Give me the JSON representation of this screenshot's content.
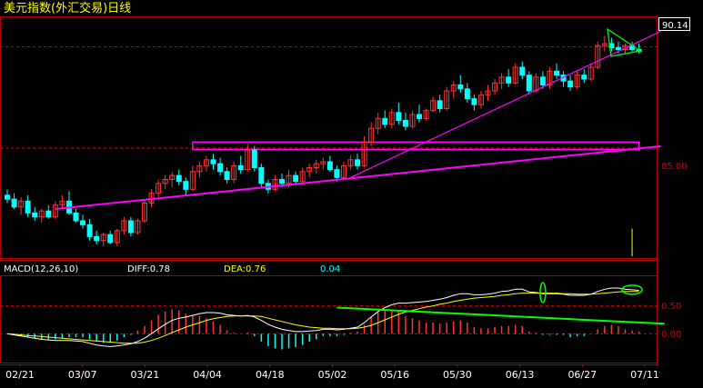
{
  "window": {
    "title": "美元指数(外汇交易)日线"
  },
  "price_panel": {
    "current_price_label": "90.14",
    "level_label": "85.00"
  },
  "macd_panel": {
    "indicator_label": "MACD(12,26,10)",
    "diff_label": "DIFF:0.78",
    "dea_label": "DEA:0.76",
    "macd_value": "0.04",
    "level_high_label": "0.50",
    "level_zero_label": "0.00"
  },
  "colors": {
    "background": "#000000",
    "up_candle": "#ff3333",
    "down_candle": "#00ffff",
    "title_text": "#ffff00",
    "trendline": "#ff00ff",
    "diff_line": "#ffffff",
    "dea_line": "#ffff00",
    "annotation_green": "#00ff00",
    "axis_red": "#cc0000"
  },
  "chart_data": [
    {
      "type": "candlestick",
      "title": "美元指数(外汇交易)日线",
      "x_tick_labels": [
        "02/21",
        "03/07",
        "03/21",
        "04/04",
        "04/18",
        "05/02",
        "05/16",
        "05/30",
        "06/13",
        "06/27",
        "07/11"
      ],
      "ylim": [
        79.5,
        91.5
      ],
      "y_reference_levels": [
        85.0,
        90.14
      ],
      "ohlc": [
        [
          82.6,
          82.9,
          82.2,
          82.4
        ],
        [
          82.4,
          82.7,
          81.9,
          82.0
        ],
        [
          82.0,
          82.5,
          81.6,
          82.3
        ],
        [
          82.3,
          82.6,
          81.5,
          81.7
        ],
        [
          81.7,
          82.0,
          81.3,
          81.5
        ],
        [
          81.5,
          81.9,
          81.2,
          81.8
        ],
        [
          81.8,
          82.1,
          81.4,
          81.5
        ],
        [
          81.5,
          82.3,
          81.4,
          82.1
        ],
        [
          82.1,
          82.6,
          81.9,
          82.3
        ],
        [
          82.3,
          82.8,
          81.6,
          81.7
        ],
        [
          81.7,
          81.9,
          81.2,
          81.3
        ],
        [
          81.3,
          81.6,
          80.9,
          81.1
        ],
        [
          81.1,
          81.4,
          80.3,
          80.5
        ],
        [
          80.5,
          80.8,
          80.1,
          80.3
        ],
        [
          80.3,
          80.7,
          80.0,
          80.6
        ],
        [
          80.6,
          80.8,
          80.1,
          80.2
        ],
        [
          80.2,
          80.9,
          80.0,
          80.8
        ],
        [
          80.8,
          81.5,
          80.6,
          81.3
        ],
        [
          81.3,
          81.5,
          80.5,
          80.7
        ],
        [
          80.7,
          81.4,
          80.6,
          81.3
        ],
        [
          81.3,
          82.4,
          81.2,
          82.2
        ],
        [
          82.2,
          82.9,
          82.0,
          82.7
        ],
        [
          82.7,
          83.4,
          82.5,
          83.2
        ],
        [
          83.2,
          83.6,
          82.9,
          83.4
        ],
        [
          83.4,
          83.8,
          83.0,
          83.6
        ],
        [
          83.6,
          83.9,
          83.1,
          83.3
        ],
        [
          83.3,
          83.5,
          82.6,
          82.9
        ],
        [
          82.9,
          84.1,
          82.8,
          83.8
        ],
        [
          83.8,
          84.3,
          83.5,
          84.1
        ],
        [
          84.1,
          84.6,
          83.8,
          84.4
        ],
        [
          84.4,
          84.7,
          83.9,
          84.2
        ],
        [
          84.2,
          84.5,
          83.6,
          83.8
        ],
        [
          83.8,
          84.0,
          83.2,
          83.4
        ],
        [
          83.4,
          84.3,
          83.2,
          84.1
        ],
        [
          84.1,
          84.6,
          83.7,
          83.9
        ],
        [
          83.9,
          85.2,
          83.8,
          84.9
        ],
        [
          84.9,
          85.1,
          83.8,
          84.0
        ],
        [
          84.0,
          84.2,
          83.0,
          83.2
        ],
        [
          83.2,
          83.4,
          82.7,
          82.9
        ],
        [
          82.9,
          83.6,
          82.8,
          83.4
        ],
        [
          83.4,
          83.7,
          83.0,
          83.2
        ],
        [
          83.2,
          83.9,
          83.0,
          83.6
        ],
        [
          83.6,
          83.8,
          83.1,
          83.3
        ],
        [
          83.3,
          84.0,
          83.2,
          83.8
        ],
        [
          83.8,
          84.2,
          83.5,
          84.0
        ],
        [
          84.0,
          84.4,
          83.7,
          84.2
        ],
        [
          84.2,
          84.5,
          83.9,
          84.3
        ],
        [
          84.3,
          84.6,
          83.8,
          83.9
        ],
        [
          83.9,
          84.1,
          83.3,
          83.5
        ],
        [
          83.5,
          84.3,
          83.4,
          84.1
        ],
        [
          84.1,
          84.6,
          83.9,
          84.4
        ],
        [
          84.4,
          84.7,
          83.9,
          84.1
        ],
        [
          84.1,
          85.6,
          84.0,
          85.3
        ],
        [
          85.3,
          86.3,
          85.1,
          86.0
        ],
        [
          86.0,
          86.8,
          85.7,
          86.5
        ],
        [
          86.5,
          86.9,
          86.0,
          86.2
        ],
        [
          86.2,
          87.0,
          86.0,
          86.8
        ],
        [
          86.8,
          87.3,
          86.2,
          86.4
        ],
        [
          86.4,
          86.8,
          85.9,
          86.1
        ],
        [
          86.1,
          86.9,
          86.0,
          86.7
        ],
        [
          86.7,
          87.2,
          86.3,
          86.5
        ],
        [
          86.5,
          87.0,
          86.4,
          86.9
        ],
        [
          86.9,
          87.6,
          86.8,
          87.4
        ],
        [
          87.4,
          87.7,
          86.8,
          87.0
        ],
        [
          87.0,
          88.1,
          86.9,
          87.9
        ],
        [
          87.9,
          88.4,
          87.5,
          88.2
        ],
        [
          88.2,
          88.7,
          87.8,
          88.0
        ],
        [
          88.0,
          88.3,
          87.3,
          87.5
        ],
        [
          87.5,
          87.7,
          86.9,
          87.2
        ],
        [
          87.2,
          87.9,
          87.0,
          87.7
        ],
        [
          87.7,
          88.2,
          87.4,
          87.9
        ],
        [
          87.9,
          88.5,
          87.7,
          88.3
        ],
        [
          88.3,
          88.8,
          88.0,
          88.6
        ],
        [
          88.6,
          89.0,
          88.1,
          88.3
        ],
        [
          88.3,
          89.3,
          88.2,
          89.1
        ],
        [
          89.1,
          89.4,
          88.5,
          88.7
        ],
        [
          88.7,
          88.9,
          87.7,
          87.9
        ],
        [
          87.9,
          88.8,
          87.8,
          88.6
        ],
        [
          88.6,
          88.9,
          88.0,
          88.2
        ],
        [
          88.2,
          89.1,
          88.0,
          88.9
        ],
        [
          88.9,
          89.3,
          88.5,
          88.7
        ],
        [
          88.7,
          88.9,
          88.1,
          88.4
        ],
        [
          88.4,
          88.7,
          87.9,
          88.1
        ],
        [
          88.1,
          88.9,
          88.0,
          88.7
        ],
        [
          88.7,
          89.0,
          88.3,
          88.5
        ],
        [
          88.5,
          89.3,
          88.4,
          89.1
        ],
        [
          89.1,
          90.4,
          89.0,
          90.2
        ],
        [
          90.2,
          90.7,
          89.9,
          90.3
        ],
        [
          90.3,
          90.6,
          89.9,
          90.1
        ],
        [
          90.1,
          90.4,
          89.8,
          90.0
        ],
        [
          90.0,
          90.3,
          89.8,
          90.2
        ],
        [
          90.2,
          90.4,
          89.9,
          90.0
        ],
        [
          90.0,
          90.3,
          89.8,
          89.9
        ]
      ],
      "trendlines": [
        {
          "from": [
            7,
            81.9
          ],
          "to": [
            92,
            85.0
          ]
        },
        {
          "from": [
            50,
            83.5
          ],
          "to": [
            92,
            90.0
          ]
        }
      ],
      "rectangle_zone": {
        "x_from": 27,
        "x_to": 92,
        "y_from": 85.0,
        "y_to": 85.3
      }
    },
    {
      "type": "macd",
      "title": "MACD(12,26,10)",
      "ylim": [
        -0.5,
        1.0
      ],
      "y_reference_levels": [
        0.5,
        0.0
      ],
      "diff": [
        0.0,
        -0.02,
        -0.04,
        -0.06,
        -0.08,
        -0.1,
        -0.11,
        -0.12,
        -0.12,
        -0.12,
        -0.13,
        -0.14,
        -0.17,
        -0.2,
        -0.22,
        -0.23,
        -0.22,
        -0.2,
        -0.18,
        -0.14,
        -0.08,
        0.0,
        0.09,
        0.17,
        0.24,
        0.28,
        0.3,
        0.33,
        0.36,
        0.38,
        0.38,
        0.37,
        0.34,
        0.33,
        0.32,
        0.33,
        0.3,
        0.24,
        0.17,
        0.12,
        0.08,
        0.06,
        0.04,
        0.04,
        0.05,
        0.06,
        0.08,
        0.08,
        0.07,
        0.08,
        0.1,
        0.12,
        0.2,
        0.3,
        0.4,
        0.47,
        0.52,
        0.55,
        0.55,
        0.56,
        0.57,
        0.58,
        0.6,
        0.62,
        0.65,
        0.69,
        0.72,
        0.72,
        0.7,
        0.7,
        0.71,
        0.73,
        0.76,
        0.77,
        0.8,
        0.8,
        0.75,
        0.74,
        0.72,
        0.72,
        0.72,
        0.71,
        0.69,
        0.69,
        0.69,
        0.71,
        0.76,
        0.8,
        0.82,
        0.82,
        0.8,
        0.79,
        0.78
      ],
      "dea": [
        0.0,
        -0.01,
        -0.02,
        -0.03,
        -0.04,
        -0.05,
        -0.06,
        -0.07,
        -0.08,
        -0.09,
        -0.1,
        -0.11,
        -0.12,
        -0.13,
        -0.14,
        -0.15,
        -0.16,
        -0.17,
        -0.17,
        -0.17,
        -0.15,
        -0.12,
        -0.08,
        -0.03,
        0.02,
        0.07,
        0.12,
        0.16,
        0.2,
        0.24,
        0.27,
        0.29,
        0.31,
        0.32,
        0.32,
        0.32,
        0.32,
        0.31,
        0.28,
        0.25,
        0.22,
        0.19,
        0.16,
        0.14,
        0.12,
        0.11,
        0.1,
        0.1,
        0.09,
        0.09,
        0.09,
        0.1,
        0.12,
        0.15,
        0.2,
        0.25,
        0.3,
        0.35,
        0.39,
        0.42,
        0.45,
        0.48,
        0.5,
        0.53,
        0.55,
        0.58,
        0.6,
        0.62,
        0.64,
        0.65,
        0.66,
        0.67,
        0.69,
        0.7,
        0.72,
        0.73,
        0.73,
        0.73,
        0.73,
        0.73,
        0.73,
        0.72,
        0.72,
        0.71,
        0.71,
        0.71,
        0.72,
        0.73,
        0.74,
        0.75,
        0.76,
        0.76,
        0.76
      ],
      "divergence_line": {
        "from": [
          48,
          0.47
        ],
        "to": [
          92,
          0.18
        ]
      },
      "current": {
        "diff": 0.78,
        "dea": 0.76,
        "macd": 0.04
      }
    }
  ]
}
